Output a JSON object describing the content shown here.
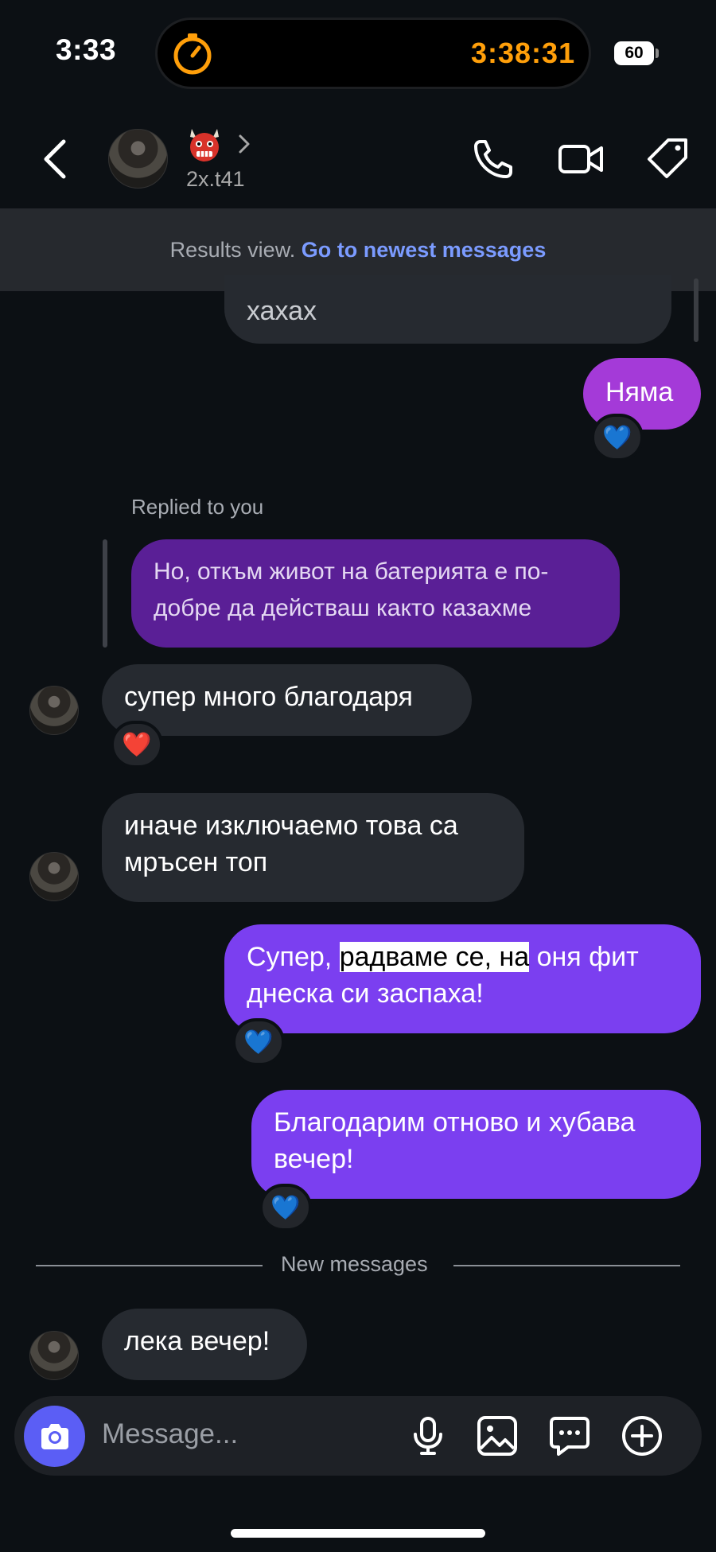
{
  "status_bar": {
    "time": "3:33",
    "timer": "3:38:31",
    "battery": "60"
  },
  "header": {
    "username": "2x.t41",
    "emoji": "👹"
  },
  "banner": {
    "text": "Results view.",
    "link": "Go to newest messages"
  },
  "messages": {
    "partial": "хахах",
    "nyama": "Няма",
    "replied_label": "Replied to you",
    "reply_quote": "Но, откъм живот на батерията е по-добре да действаш както казахме",
    "m1": "супер много благодаря",
    "m2": "иначе изключаемо това са мръсен топ",
    "m3_a": "Супер, ",
    "m3_b": "радваме се, на",
    "m3_c": " оня фит днеска си заспаха!",
    "m4": "Благодарим отново и хубава вечер!",
    "divider": "New messages",
    "m5": "лека вечер!"
  },
  "reactions": {
    "blue_heart": "💙",
    "red_heart": "❤️"
  },
  "composer": {
    "placeholder": "Message..."
  },
  "colors": {
    "accent": "#7b3ff0",
    "link": "#7b9bff",
    "timer": "#ff9f0a"
  }
}
